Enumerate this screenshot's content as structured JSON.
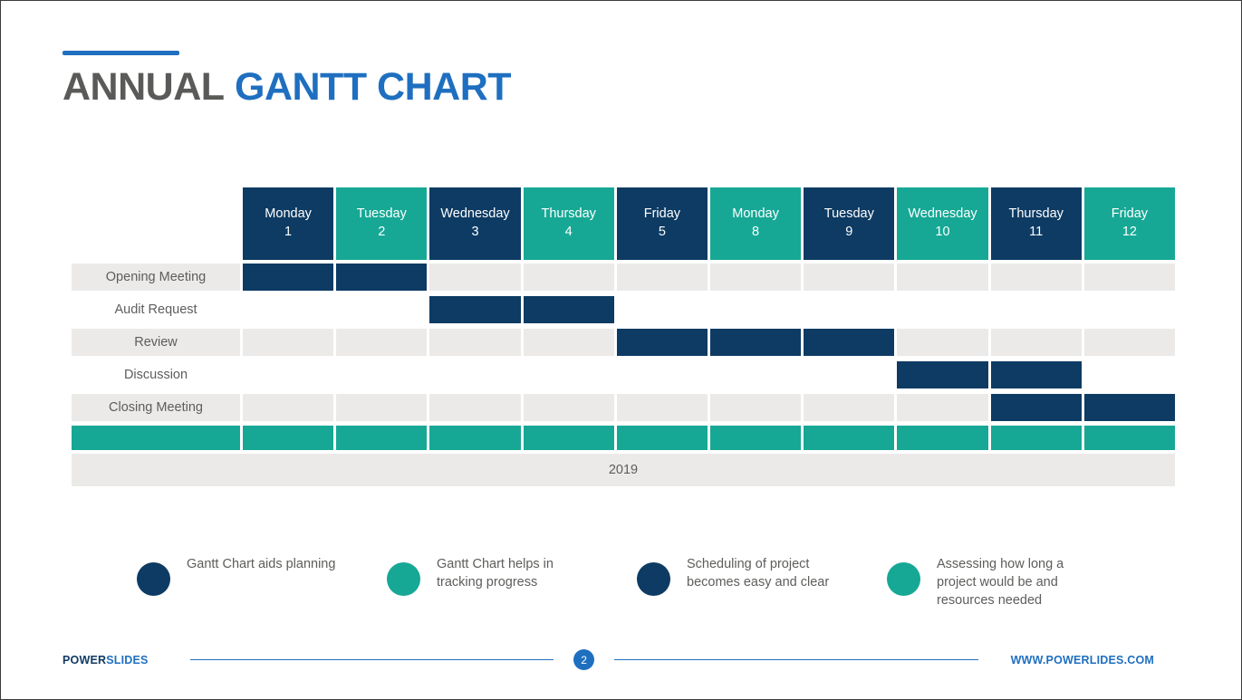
{
  "slide": {
    "title_part1": "ANNUAL",
    "title_part2": "GANTT CHART",
    "accent_blue": "#1f6fc0",
    "navy": "#0d3b63",
    "teal": "#16a895",
    "row_gray": "#ebeae8"
  },
  "chart_data": {
    "type": "gantt",
    "title": "ANNUAL GANTT CHART",
    "year_label": "2019",
    "columns": [
      {
        "day": "Monday",
        "date": "1",
        "color": "navy"
      },
      {
        "day": "Tuesday",
        "date": "2",
        "color": "teal"
      },
      {
        "day": "Wednesday",
        "date": "3",
        "color": "navy"
      },
      {
        "day": "Thursday",
        "date": "4",
        "color": "teal"
      },
      {
        "day": "Friday",
        "date": "5",
        "color": "navy"
      },
      {
        "day": "Monday",
        "date": "8",
        "color": "teal"
      },
      {
        "day": "Tuesday",
        "date": "9",
        "color": "navy"
      },
      {
        "day": "Wednesday",
        "date": "10",
        "color": "teal"
      },
      {
        "day": "Thursday",
        "date": "11",
        "color": "navy"
      },
      {
        "day": "Friday",
        "date": "12",
        "color": "teal"
      }
    ],
    "tasks": [
      {
        "name": "Opening Meeting",
        "start": 1,
        "end": 2,
        "shaded": true
      },
      {
        "name": "Audit Request",
        "start": 3,
        "end": 4,
        "shaded": false
      },
      {
        "name": "Review",
        "start": 5,
        "end": 7,
        "shaded": true
      },
      {
        "name": "Discussion",
        "start": 8,
        "end": 9,
        "shaded": false
      },
      {
        "name": "Closing Meeting",
        "start": 9,
        "end": 10,
        "shaded": true
      }
    ]
  },
  "legend": {
    "items": [
      {
        "color": "navy",
        "text": "Gantt Chart aids planning"
      },
      {
        "color": "teal",
        "text": "Gantt Chart helps in tracking progress"
      },
      {
        "color": "navy",
        "text": "Scheduling of project becomes easy and clear"
      },
      {
        "color": "teal",
        "text": "Assessing how long a project would be and resources needed"
      }
    ]
  },
  "footer": {
    "brand_part1": "POWER",
    "brand_part2": "SLIDES",
    "page_number": "2",
    "website": "WWW.POWERLIDES.COM"
  }
}
